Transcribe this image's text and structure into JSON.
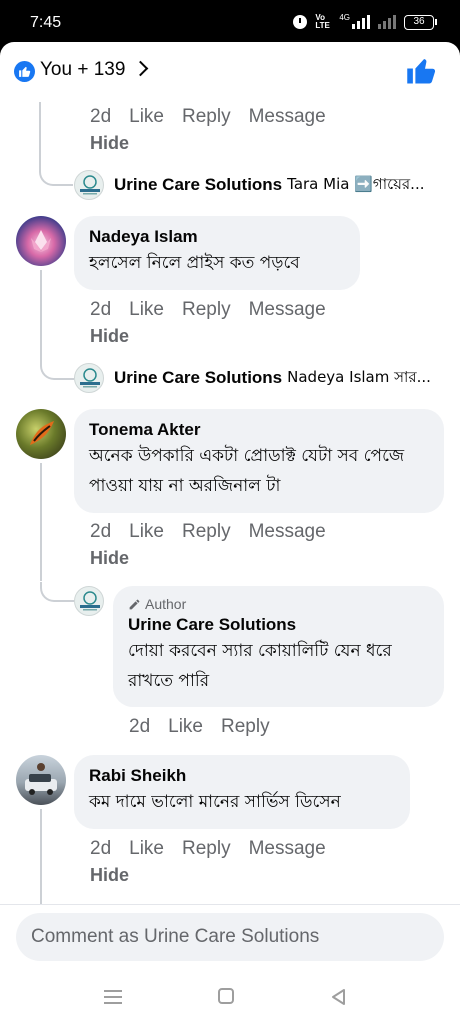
{
  "status_bar": {
    "time": "7:45",
    "network": "4G",
    "battery": "36",
    "volte_line1": "Vo",
    "volte_line2": "LTE"
  },
  "header": {
    "reactions_text": "You + 139"
  },
  "actions": {
    "time": "2d",
    "like": "Like",
    "reply": "Reply",
    "message": "Message",
    "hide": "Hide"
  },
  "thread1": {
    "reply_name": "Urine Care Solutions",
    "reply_preview": "Tara Mia ➡️গায়ের..."
  },
  "thread2": {
    "name": "Nadeya Islam",
    "text": "হলসেল নিলে প্রাইস কত পড়বে",
    "reply_name": "Urine Care Solutions",
    "reply_preview": "Nadeya Islam সার..."
  },
  "thread3": {
    "name": "Tonema Akter",
    "text": "অনেক উপকারি একটা প্রোডাক্ট যেটা সব পেজে পাওয়া যায় না অরজিনাল টা",
    "reply": {
      "author_tag": "Author",
      "name": "Urine Care Solutions",
      "text": "দোয়া করবেন স্যার কোয়ালিটি যেন ধরে রাখতে পারি"
    }
  },
  "thread4": {
    "name": "Rabi Sheikh",
    "text": "কম দামে ভালো মানের সার্ভিস ডিসেন"
  },
  "composer": {
    "placeholder": "Comment as Urine Care Solutions"
  },
  "colors": {
    "brand_blue": "#1877f2",
    "bubble": "#f0f2f5",
    "meta_gray": "#65676b"
  }
}
